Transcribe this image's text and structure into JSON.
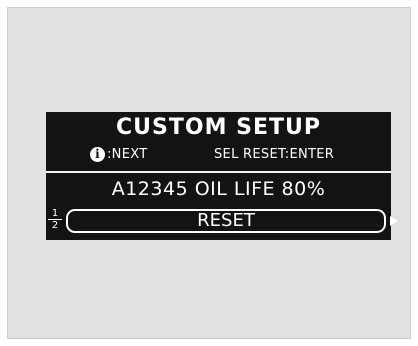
{
  "display": {
    "title": "CUSTOM SETUP",
    "hints": {
      "info_icon": "i",
      "next_label": ":NEXT",
      "sel_label": "SEL RESET:ENTER"
    },
    "status_line": "A12345 OIL LIFE 80%",
    "page": {
      "current": "1",
      "total": "2"
    },
    "reset_label": "RESET",
    "arrow_icon": "right-triangle"
  },
  "colors": {
    "screen_bg": "#131313",
    "text": "#ffffff",
    "panel_bg": "#e1e1e3"
  }
}
